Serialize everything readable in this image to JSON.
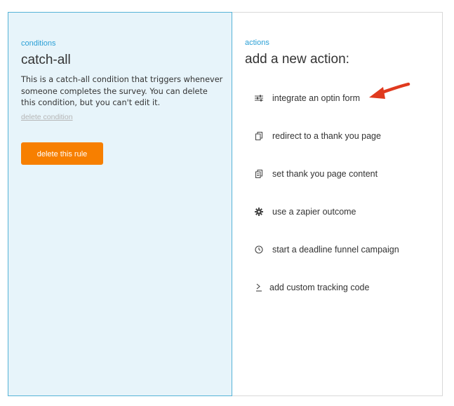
{
  "conditions": {
    "section_label": "conditions",
    "title": "catch-all",
    "description": "This is a catch-all condition that triggers whenever someone completes the survey. You can delete this condition, but you can't edit it.",
    "delete_condition_link": "delete condition",
    "delete_rule_button": "delete this rule"
  },
  "actions": {
    "section_label": "actions",
    "title": "add a new action:",
    "items": [
      {
        "label": "integrate an optin form",
        "icon": "sliders-icon"
      },
      {
        "label": "redirect to a thank you page",
        "icon": "page-copy-icon"
      },
      {
        "label": "set thank you page content",
        "icon": "page-edit-icon"
      },
      {
        "label": "use a zapier outcome",
        "icon": "gear-icon"
      },
      {
        "label": "start a deadline funnel campaign",
        "icon": "clock-icon"
      },
      {
        "label": "add custom tracking code",
        "icon": "code-prompt-icon"
      }
    ]
  },
  "colors": {
    "accent": "#2ba0d6",
    "button": "#f77f00",
    "panel_bg": "#e7f4fa",
    "arrow": "#e03a1e"
  }
}
